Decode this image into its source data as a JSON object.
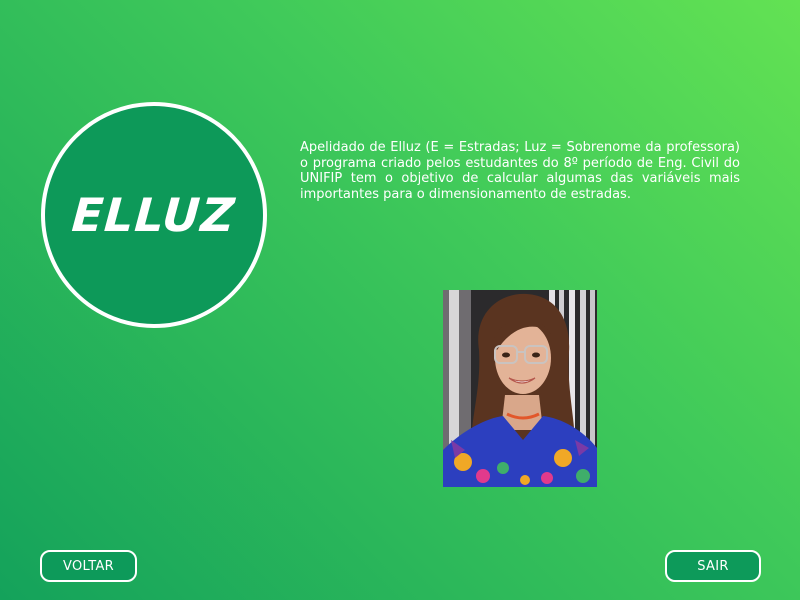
{
  "logo": {
    "text": "ELLUZ"
  },
  "description": {
    "text": "Apelidado de Elluz (E = Estradas; Luz = Sobrenome da professora) o programa criado pelos estudantes do 8º período de Eng. Civil do UNIFIP tem o objetivo de calcular algumas das variáveis mais importantes para o dimensionamento de estradas."
  },
  "photo": {
    "icon": "professor-photo"
  },
  "buttons": {
    "back_label": "VOLTAR",
    "exit_label": "SAIR"
  },
  "colors": {
    "background_start": "#14a25b",
    "background_end": "#63e253",
    "logo_fill": "#0d9959",
    "button_fill": "#0d9a5a",
    "border": "#ffffff"
  }
}
